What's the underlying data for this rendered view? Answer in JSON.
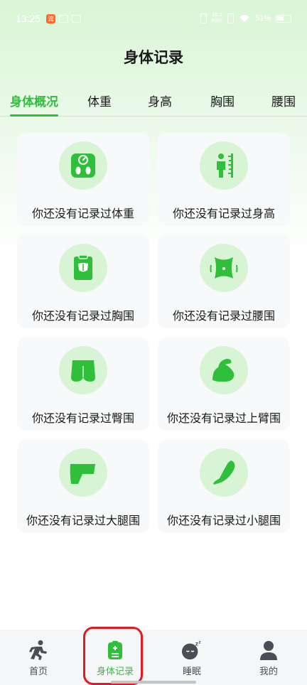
{
  "status_bar": {
    "time": "13:25",
    "battery": "51%",
    "net_label": "26.0\nKB/s"
  },
  "header": {
    "title": "身体记录"
  },
  "tabs": [
    {
      "label": "身体概况",
      "active": true
    },
    {
      "label": "体重",
      "active": false
    },
    {
      "label": "身高",
      "active": false
    },
    {
      "label": "胸围",
      "active": false
    },
    {
      "label": "腰围",
      "active": false
    }
  ],
  "cards": [
    {
      "icon": "scale-icon",
      "label": "你还没有记录过体重"
    },
    {
      "icon": "height-ruler-icon",
      "label": "你还没有记录过身高"
    },
    {
      "icon": "chest-icon",
      "label": "你还没有记录过胸围"
    },
    {
      "icon": "waist-icon",
      "label": "你还没有记录过腰围"
    },
    {
      "icon": "hip-icon",
      "label": "你还没有记录过臀围"
    },
    {
      "icon": "bicep-icon",
      "label": "你还没有记录过上臂围"
    },
    {
      "icon": "thigh-icon",
      "label": "你还没有记录过大腿围"
    },
    {
      "icon": "calf-icon",
      "label": "你还没有记录过小腿围"
    }
  ],
  "bottom_nav": [
    {
      "icon": "running-icon",
      "label": "首页",
      "active": false
    },
    {
      "icon": "body-record-icon",
      "label": "身体记录",
      "active": true
    },
    {
      "icon": "sleep-icon",
      "label": "睡眠",
      "active": false
    },
    {
      "icon": "user-icon",
      "label": "我的",
      "active": false
    }
  ],
  "colors": {
    "accent": "#2fbf3a",
    "icon_bg": "#d7f5d5",
    "card_bg": "#f7f9fa",
    "highlight": "#e01b24"
  }
}
